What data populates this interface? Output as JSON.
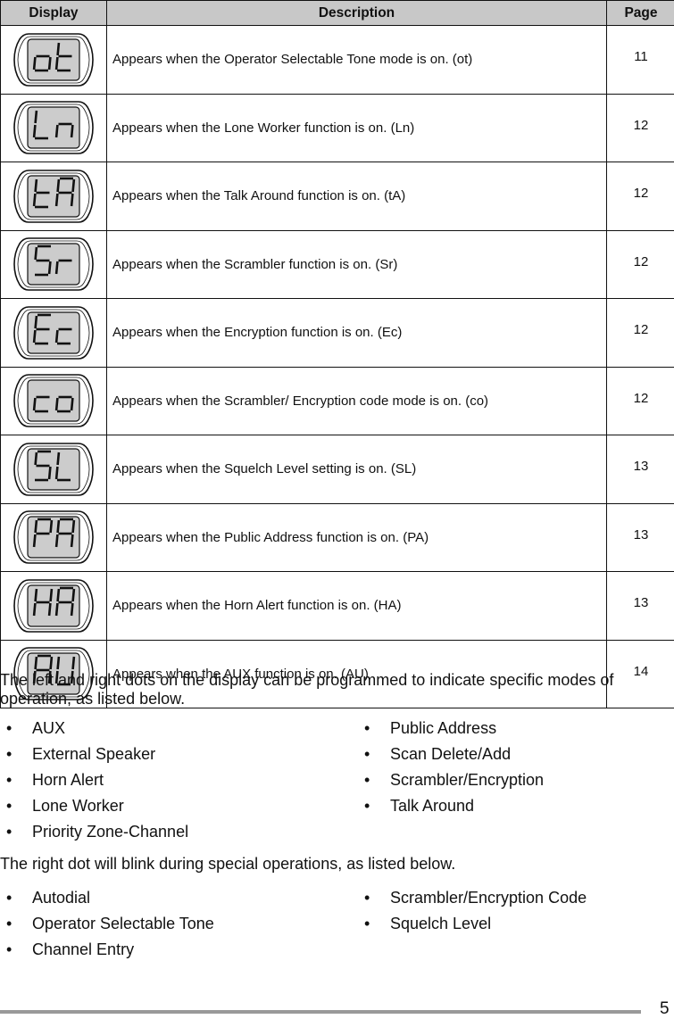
{
  "table": {
    "headers": {
      "display": "Display",
      "description": "Description",
      "page": "Page"
    },
    "rows": [
      {
        "code": "ot",
        "description": "Appears when the Operator Selectable Tone mode is on. (ot)",
        "page": "11"
      },
      {
        "code": "Ln",
        "description": "Appears when the Lone Worker function is on. (Ln)",
        "page": "12"
      },
      {
        "code": "tA",
        "description": "Appears when the Talk Around function is on. (tA)",
        "page": "12"
      },
      {
        "code": "Sr",
        "description": "Appears when the Scrambler function is on. (Sr)",
        "page": "12"
      },
      {
        "code": "Ec",
        "description": "Appears when the Encryption function is on. (Ec)",
        "page": "12"
      },
      {
        "code": "co",
        "description": "Appears when the Scrambler/ Encryption code mode is on. (co)",
        "page": "12"
      },
      {
        "code": "SL",
        "description": "Appears when the Squelch Level setting is on. (SL)",
        "page": "13"
      },
      {
        "code": "PA",
        "description": "Appears when the Public Address function is on. (PA)",
        "page": "13"
      },
      {
        "code": "HA",
        "description": "Appears when the Horn Alert function is on.  (HA)",
        "page": "13"
      },
      {
        "code": "AU",
        "description": "Appears when the AUX function is on. (AU)",
        "page": "14"
      }
    ]
  },
  "dots_section": {
    "intro": "The left and right dots on the display can be programmed to indicate specific modes of operation, as listed below.",
    "left_list": [
      "AUX",
      "External Speaker",
      "Horn Alert",
      "Lone Worker",
      "Priority Zone-Channel"
    ],
    "right_list": [
      "Public Address",
      "Scan Delete/Add",
      "Scrambler/Encryption",
      "Talk Around"
    ]
  },
  "blink_section": {
    "intro": "The right dot will blink during special operations, as listed below.",
    "left_list": [
      "Autodial",
      "Operator Selectable Tone",
      "Channel Entry"
    ],
    "right_list": [
      "Scrambler/Encryption Code",
      "Squelch Level"
    ]
  },
  "footer": {
    "page_number": "5"
  },
  "colors": {
    "header_bg": "#c8c8c8",
    "lcd_screen": "#cccccc",
    "footer_rule": "#999999"
  }
}
